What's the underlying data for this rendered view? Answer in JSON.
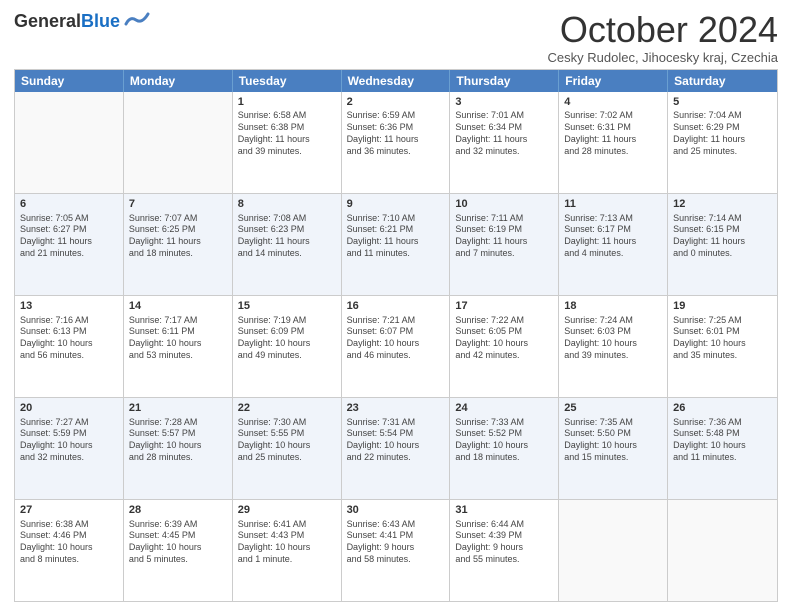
{
  "header": {
    "logo_line1": "General",
    "logo_line2": "Blue",
    "month": "October 2024",
    "location": "Cesky Rudolec, Jihocesky kraj, Czechia"
  },
  "weekdays": [
    "Sunday",
    "Monday",
    "Tuesday",
    "Wednesday",
    "Thursday",
    "Friday",
    "Saturday"
  ],
  "rows": [
    [
      {
        "day": "",
        "info": ""
      },
      {
        "day": "",
        "info": ""
      },
      {
        "day": "1",
        "info": "Sunrise: 6:58 AM\nSunset: 6:38 PM\nDaylight: 11 hours\nand 39 minutes."
      },
      {
        "day": "2",
        "info": "Sunrise: 6:59 AM\nSunset: 6:36 PM\nDaylight: 11 hours\nand 36 minutes."
      },
      {
        "day": "3",
        "info": "Sunrise: 7:01 AM\nSunset: 6:34 PM\nDaylight: 11 hours\nand 32 minutes."
      },
      {
        "day": "4",
        "info": "Sunrise: 7:02 AM\nSunset: 6:31 PM\nDaylight: 11 hours\nand 28 minutes."
      },
      {
        "day": "5",
        "info": "Sunrise: 7:04 AM\nSunset: 6:29 PM\nDaylight: 11 hours\nand 25 minutes."
      }
    ],
    [
      {
        "day": "6",
        "info": "Sunrise: 7:05 AM\nSunset: 6:27 PM\nDaylight: 11 hours\nand 21 minutes."
      },
      {
        "day": "7",
        "info": "Sunrise: 7:07 AM\nSunset: 6:25 PM\nDaylight: 11 hours\nand 18 minutes."
      },
      {
        "day": "8",
        "info": "Sunrise: 7:08 AM\nSunset: 6:23 PM\nDaylight: 11 hours\nand 14 minutes."
      },
      {
        "day": "9",
        "info": "Sunrise: 7:10 AM\nSunset: 6:21 PM\nDaylight: 11 hours\nand 11 minutes."
      },
      {
        "day": "10",
        "info": "Sunrise: 7:11 AM\nSunset: 6:19 PM\nDaylight: 11 hours\nand 7 minutes."
      },
      {
        "day": "11",
        "info": "Sunrise: 7:13 AM\nSunset: 6:17 PM\nDaylight: 11 hours\nand 4 minutes."
      },
      {
        "day": "12",
        "info": "Sunrise: 7:14 AM\nSunset: 6:15 PM\nDaylight: 11 hours\nand 0 minutes."
      }
    ],
    [
      {
        "day": "13",
        "info": "Sunrise: 7:16 AM\nSunset: 6:13 PM\nDaylight: 10 hours\nand 56 minutes."
      },
      {
        "day": "14",
        "info": "Sunrise: 7:17 AM\nSunset: 6:11 PM\nDaylight: 10 hours\nand 53 minutes."
      },
      {
        "day": "15",
        "info": "Sunrise: 7:19 AM\nSunset: 6:09 PM\nDaylight: 10 hours\nand 49 minutes."
      },
      {
        "day": "16",
        "info": "Sunrise: 7:21 AM\nSunset: 6:07 PM\nDaylight: 10 hours\nand 46 minutes."
      },
      {
        "day": "17",
        "info": "Sunrise: 7:22 AM\nSunset: 6:05 PM\nDaylight: 10 hours\nand 42 minutes."
      },
      {
        "day": "18",
        "info": "Sunrise: 7:24 AM\nSunset: 6:03 PM\nDaylight: 10 hours\nand 39 minutes."
      },
      {
        "day": "19",
        "info": "Sunrise: 7:25 AM\nSunset: 6:01 PM\nDaylight: 10 hours\nand 35 minutes."
      }
    ],
    [
      {
        "day": "20",
        "info": "Sunrise: 7:27 AM\nSunset: 5:59 PM\nDaylight: 10 hours\nand 32 minutes."
      },
      {
        "day": "21",
        "info": "Sunrise: 7:28 AM\nSunset: 5:57 PM\nDaylight: 10 hours\nand 28 minutes."
      },
      {
        "day": "22",
        "info": "Sunrise: 7:30 AM\nSunset: 5:55 PM\nDaylight: 10 hours\nand 25 minutes."
      },
      {
        "day": "23",
        "info": "Sunrise: 7:31 AM\nSunset: 5:54 PM\nDaylight: 10 hours\nand 22 minutes."
      },
      {
        "day": "24",
        "info": "Sunrise: 7:33 AM\nSunset: 5:52 PM\nDaylight: 10 hours\nand 18 minutes."
      },
      {
        "day": "25",
        "info": "Sunrise: 7:35 AM\nSunset: 5:50 PM\nDaylight: 10 hours\nand 15 minutes."
      },
      {
        "day": "26",
        "info": "Sunrise: 7:36 AM\nSunset: 5:48 PM\nDaylight: 10 hours\nand 11 minutes."
      }
    ],
    [
      {
        "day": "27",
        "info": "Sunrise: 6:38 AM\nSunset: 4:46 PM\nDaylight: 10 hours\nand 8 minutes."
      },
      {
        "day": "28",
        "info": "Sunrise: 6:39 AM\nSunset: 4:45 PM\nDaylight: 10 hours\nand 5 minutes."
      },
      {
        "day": "29",
        "info": "Sunrise: 6:41 AM\nSunset: 4:43 PM\nDaylight: 10 hours\nand 1 minute."
      },
      {
        "day": "30",
        "info": "Sunrise: 6:43 AM\nSunset: 4:41 PM\nDaylight: 9 hours\nand 58 minutes."
      },
      {
        "day": "31",
        "info": "Sunrise: 6:44 AM\nSunset: 4:39 PM\nDaylight: 9 hours\nand 55 minutes."
      },
      {
        "day": "",
        "info": ""
      },
      {
        "day": "",
        "info": ""
      }
    ]
  ]
}
